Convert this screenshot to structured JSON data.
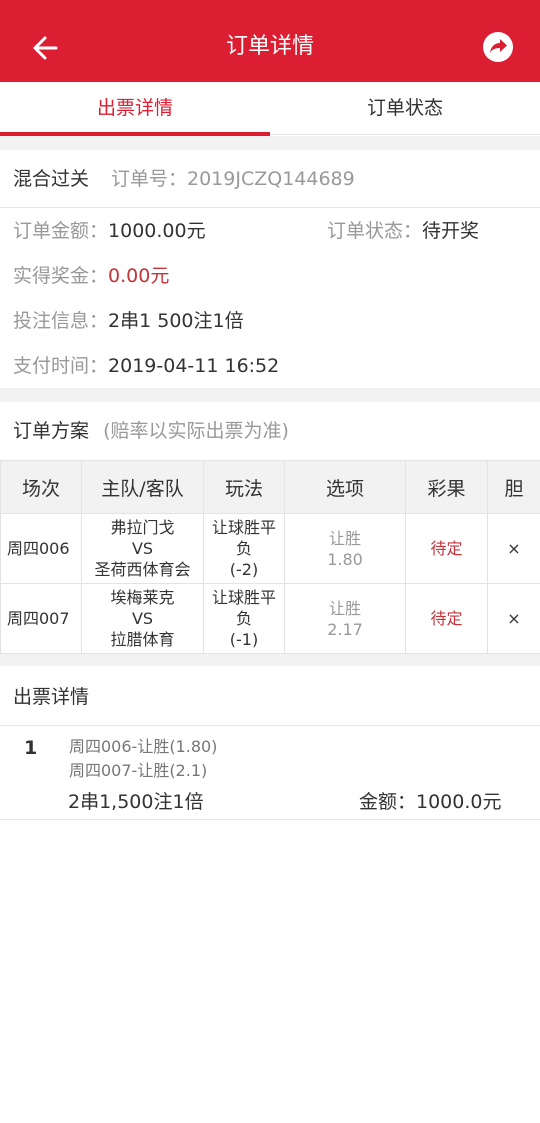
{
  "header": {
    "title": "订单详情",
    "back_icon": "arrow-left-icon",
    "share_icon": "share-icon"
  },
  "tabs": [
    {
      "label": "出票详情",
      "active": true
    },
    {
      "label": "订单状态",
      "active": false
    }
  ],
  "order": {
    "type": "混合过关",
    "order_no": "订单号：2019JCZQ144689",
    "amount_label": "订单金额：",
    "amount": "1000.00元",
    "status_label": "订单状态：",
    "status": "待开奖",
    "prize_label": "实得奖金：",
    "prize": "0.00元",
    "bet_label": "投注信息：",
    "bet": "2串1 500注1倍",
    "pay_label": "支付时间：",
    "pay_time": "2019-04-11 16:52"
  },
  "plan": {
    "title": "订单方案",
    "note": "(赔率以实际出票为准)",
    "columns": [
      "场次",
      "主队/客队",
      "玩法",
      "选项",
      "彩果",
      "胆"
    ],
    "rows": [
      {
        "match": "周四006",
        "home": "弗拉门戈",
        "vs": "VS",
        "away": "圣荷西体育会",
        "play_a": "让球胜平",
        "play_b": "负",
        "play_c": "(-2)",
        "option": "让胜",
        "odds": "1.80",
        "result": "待定",
        "banker": "×"
      },
      {
        "match": "周四007",
        "home": "埃梅莱克",
        "vs": "VS",
        "away": "拉腊体育",
        "play_a": "让球胜平",
        "play_b": "负",
        "play_c": "(-1)",
        "option": "让胜",
        "odds": "2.17",
        "result": "待定",
        "banker": "×"
      }
    ]
  },
  "tickets": {
    "title": "出票详情",
    "items": [
      {
        "index": "1",
        "line1": "周四006-让胜(1.80)",
        "line2": "周四007-让胜(2.1)",
        "bet": "2串1,500注1倍",
        "amount": "金额：1000.0元"
      }
    ]
  },
  "colors": {
    "brand_red": "#dc1e32",
    "text_red": "#c4343b",
    "bg_gray": "#f2f2f2"
  }
}
